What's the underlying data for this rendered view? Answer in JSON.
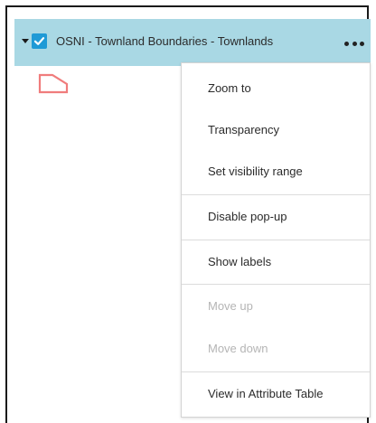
{
  "layer": {
    "title": "OSNI - Townland Boundaries - Townlands",
    "checked": true,
    "symbol_color": "#f07c7c",
    "row_color": "#a9d8e4"
  },
  "icons": {
    "expand": "caret-down-icon",
    "checkbox": "checkbox-checked-icon",
    "more": "ellipsis-icon",
    "symbol": "polygon-symbol-icon"
  },
  "menu": {
    "items": [
      {
        "label": "Zoom to",
        "enabled": true
      },
      {
        "label": "Transparency",
        "enabled": true
      },
      {
        "label": "Set visibility range",
        "enabled": true
      },
      {
        "label": "Disable pop-up",
        "enabled": true
      },
      {
        "label": "Show labels",
        "enabled": true
      },
      {
        "label": "Move up",
        "enabled": false
      },
      {
        "label": "Move down",
        "enabled": false
      },
      {
        "label": "View in Attribute Table",
        "enabled": true
      }
    ]
  }
}
